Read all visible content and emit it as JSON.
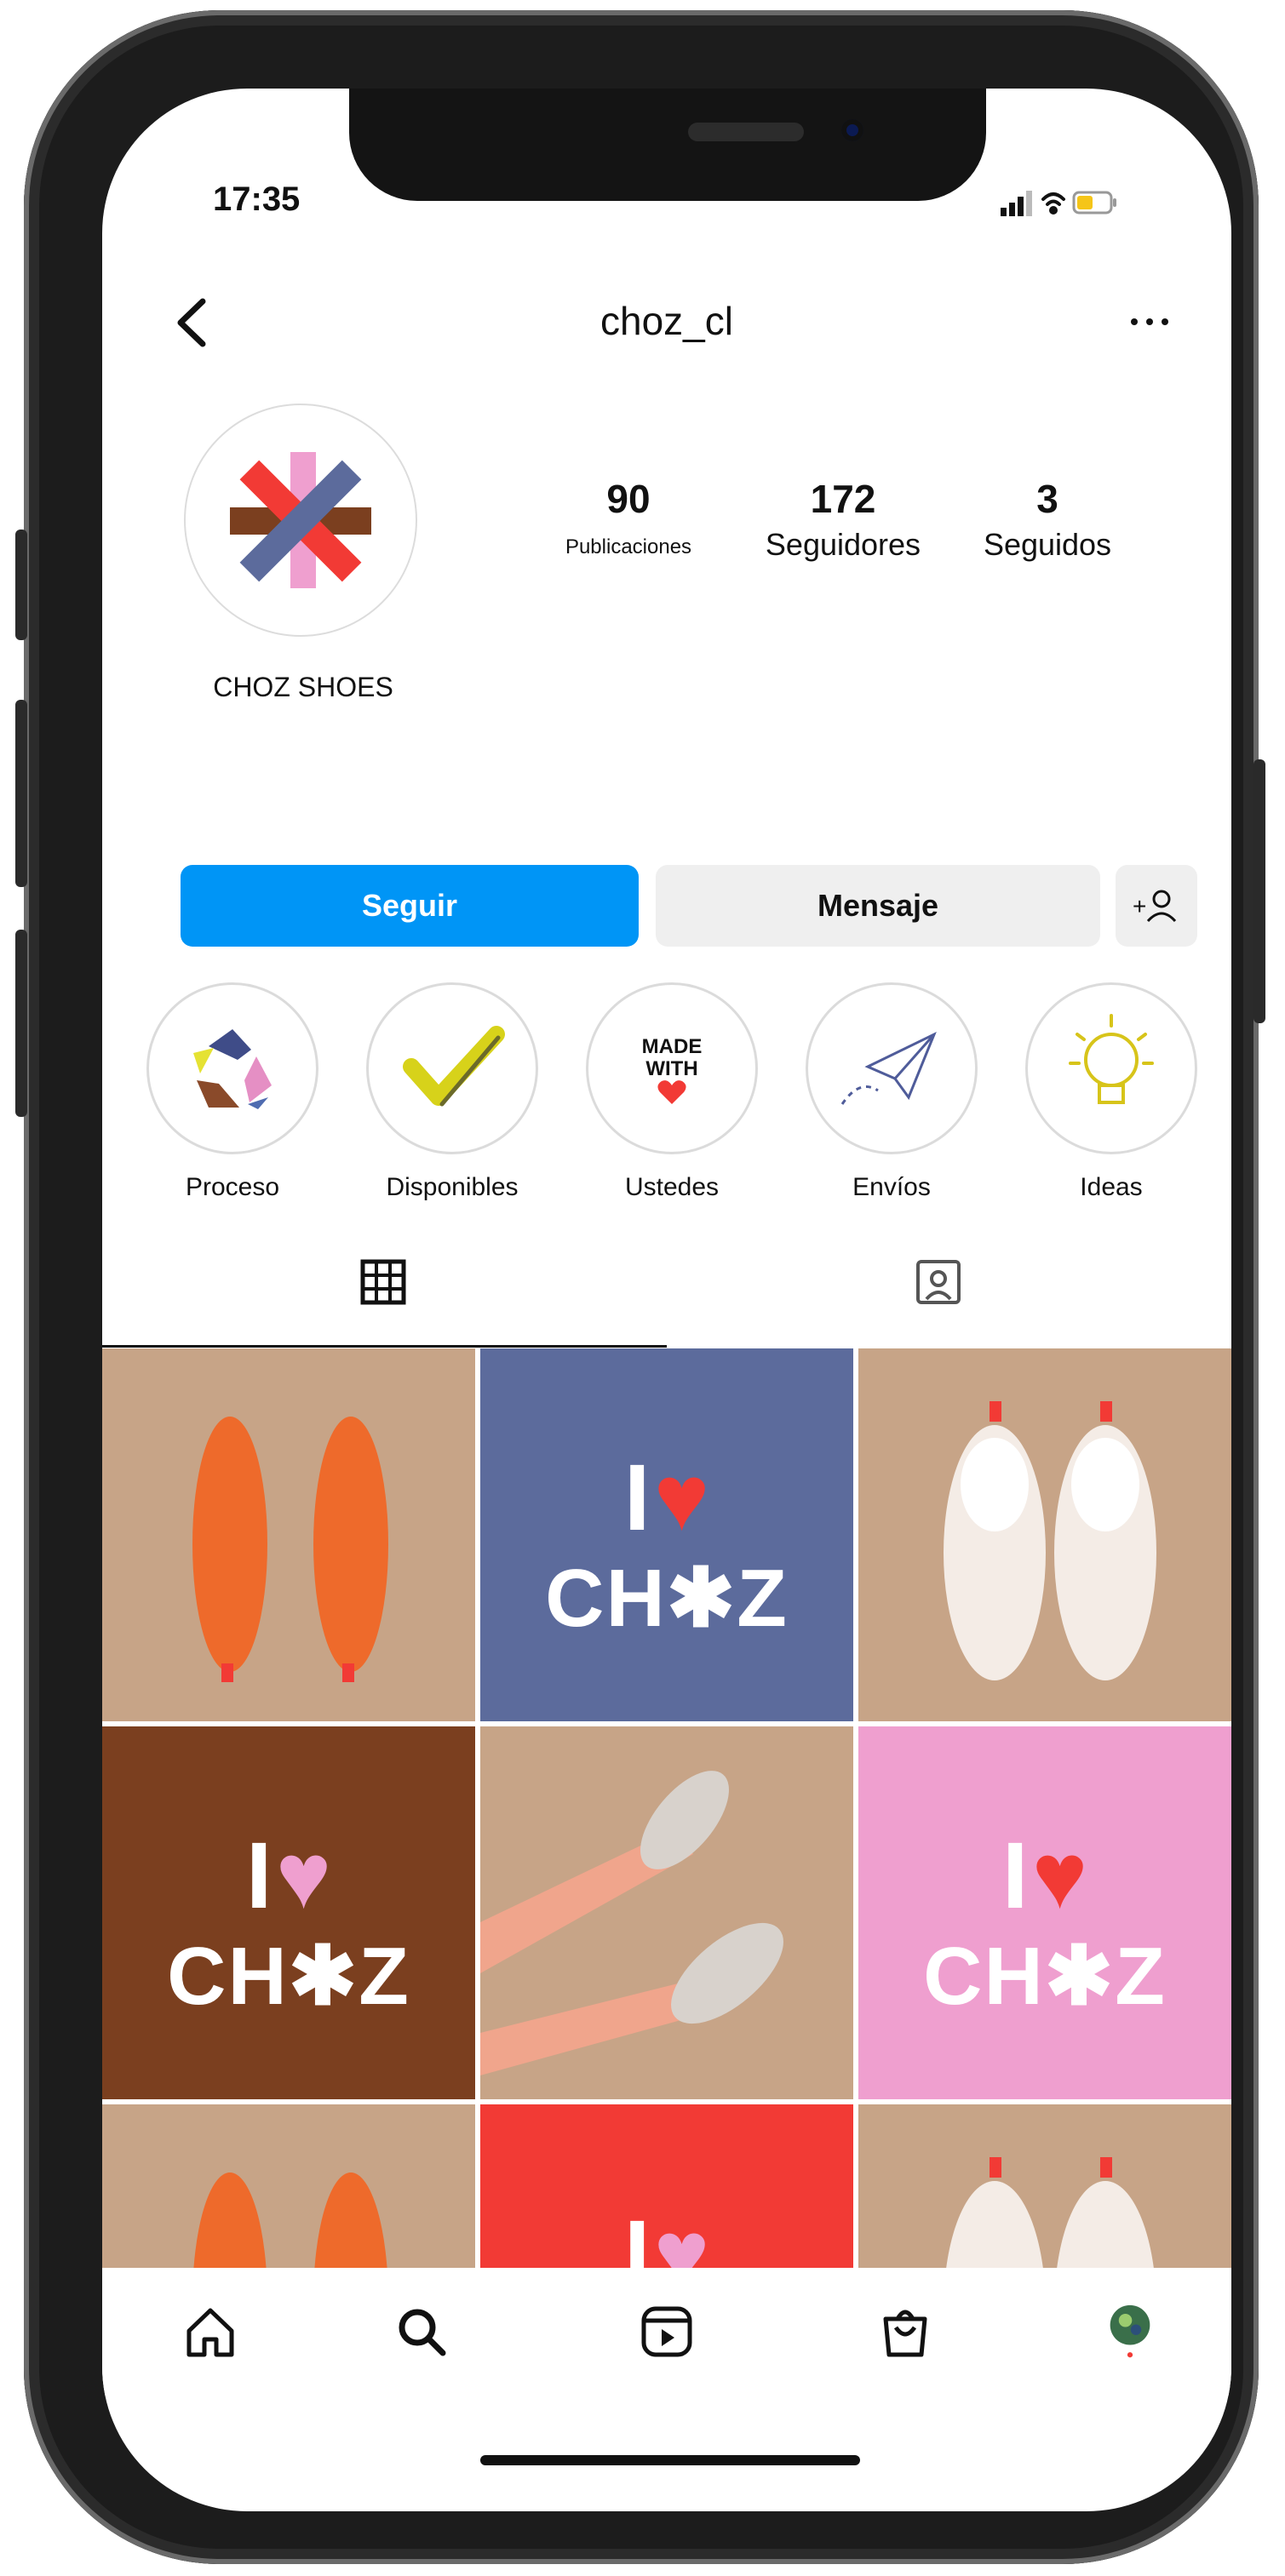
{
  "status_bar": {
    "time": "17:35"
  },
  "header": {
    "username": "choz_cl"
  },
  "profile": {
    "display_name": "CHOZ SHOES",
    "stats": [
      {
        "value": "90",
        "label": "Publicaciones"
      },
      {
        "value": "172",
        "label": "Seguidores"
      },
      {
        "value": "3",
        "label": "Seguidos"
      }
    ]
  },
  "actions": {
    "follow_label": "Seguir",
    "message_label": "Mensaje"
  },
  "highlights": [
    {
      "label": "Proceso",
      "icon": "recycle-icon"
    },
    {
      "label": "Disponibles",
      "icon": "checkmark-icon"
    },
    {
      "label": "Ustedes",
      "icon": "made-with-love-icon",
      "badge_line1": "MADE",
      "badge_line2": "WITH"
    },
    {
      "label": "Envíos",
      "icon": "paper-plane-icon"
    },
    {
      "label": "Ideas",
      "icon": "lightbulb-icon"
    }
  ],
  "tabs": [
    {
      "name": "grid-tab",
      "active": true
    },
    {
      "name": "tagged-tab",
      "active": false
    }
  ],
  "posts": {
    "love_text": {
      "i": "I",
      "word": "CH✱Z"
    },
    "colors": {
      "tan": "#c7a487",
      "blue": "#5c6b9c",
      "brown": "#7b3f1f",
      "pink": "#ef9fcf",
      "red": "#f23a35",
      "white": "#ffffff"
    }
  },
  "bottom_nav": [
    "home-icon",
    "search-icon",
    "reels-icon",
    "shop-icon",
    "profile-avatar-icon"
  ],
  "colors": {
    "accent": "#0095f6",
    "button_gray": "#efefef",
    "text": "#111111"
  }
}
